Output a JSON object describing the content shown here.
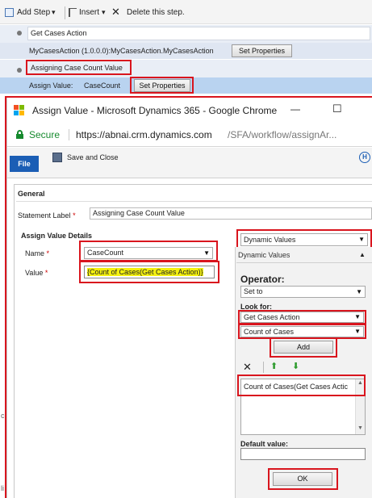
{
  "toolbar": {
    "add_step": "Add Step",
    "insert": "Insert",
    "delete": "Delete this step.",
    "dropdown_glyph": "▾"
  },
  "steps": {
    "step1_title": "Get Cases Action",
    "step1_action": "MyCasesAction (1.0.0.0):MyCasesAction.MyCasesAction",
    "step1_set_props": "Set Properties",
    "step2_title": "Assigning Case Count Value",
    "step2_assign_label": "Assign Value:",
    "step2_assign_value": "CaseCount",
    "step2_set_props": "Set Properties"
  },
  "popup": {
    "title": "Assign Value - Microsoft Dynamics 365 - Google Chrome",
    "min": "—",
    "max": "☐",
    "close": "✕",
    "secure": "Secure",
    "url_host": "https://abnai.crm.dynamics.com",
    "url_path": "/SFA/workflow/assignAr...",
    "file_tab": "File",
    "save_close": "Save and Close",
    "help": "H",
    "general": "General",
    "statement_label": "Statement Label",
    "statement_value": "Assigning Case Count Value",
    "details": "Assign Value Details",
    "name_label": "Name",
    "name_value": "CaseCount",
    "value_label": "Value",
    "value_value": "{Count of Cases(Get Cases Action)}",
    "required": "*"
  },
  "side": {
    "dropdown_value": "Dynamic Values",
    "header": "Dynamic Values",
    "operator": "Operator:",
    "set_to": "Set to",
    "look_for": "Look for:",
    "look_entity": "Get Cases Action",
    "look_field": "Count of Cases",
    "add": "Add",
    "list_item": "Count of Cases(Get Cases Actic",
    "default_value": "Default value:",
    "ok": "OK",
    "clear_glyph": "✕",
    "up_glyph": "⬆",
    "down_glyph": "⬇",
    "collapse_glyph": "▲",
    "scroll_up": "▲",
    "scroll_down": "▼"
  },
  "left_edge": {
    "c": "c",
    "li": "li"
  }
}
